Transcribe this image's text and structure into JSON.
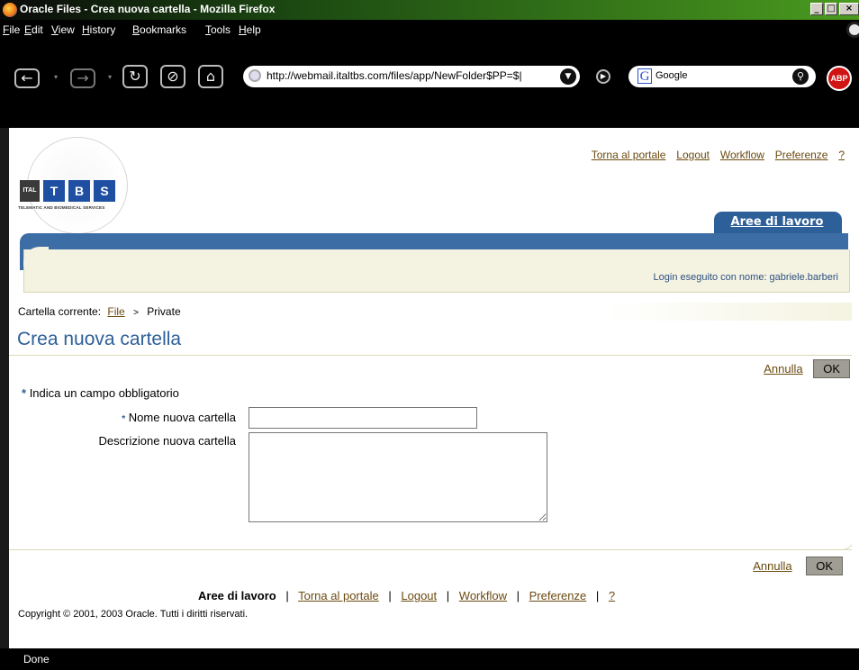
{
  "window": {
    "title": "Oracle Files - Crea nuova cartella - Mozilla Firefox",
    "buttons": [
      "_",
      "□",
      "×"
    ]
  },
  "menu": [
    "File",
    "Edit",
    "View",
    "History",
    "Bookmarks",
    "Tools",
    "Help"
  ],
  "toolbar": {
    "back_glyph": "←",
    "forward_glyph": "→",
    "reload_glyph": "↻",
    "stop_glyph": "⊘",
    "home_glyph": "⌂",
    "url": "http://webmail.italtbs.com/files/app/NewFolder$PP=$|",
    "search_engine": "Google",
    "search_engine_glyph": "G",
    "adblock_label": "ABP"
  },
  "logo": {
    "letters": [
      "ITAL",
      "T",
      "B",
      "S"
    ],
    "tagline": "TELEMATIC AND BIOMEDICAL SERVICES",
    "colors": {
      "box_blue": "#1f4fa3",
      "box_dark": "#3a3a3a"
    }
  },
  "global_links": [
    "Torna al portale",
    "Logout",
    "Workflow",
    "Preferenze",
    "?"
  ],
  "tab": {
    "label": "Aree di lavoro"
  },
  "login": {
    "text": "Login eseguito con nome: gabriele.barberi"
  },
  "breadcrumb": {
    "prefix": "Cartella corrente:",
    "link": "File",
    "separator": ">",
    "current": "Private"
  },
  "page": {
    "title": "Crea nuova cartella",
    "required_note": "Indica un campo obbligatorio",
    "required_star": "*"
  },
  "form": {
    "name_label": "Nome nuova cartella",
    "name_value": "",
    "desc_label": "Descrizione nuova cartella",
    "desc_value": ""
  },
  "actions": {
    "cancel": "Annulla",
    "ok": "OK"
  },
  "footer": {
    "current": "Aree di lavoro",
    "links": [
      "Torna al portale",
      "Logout",
      "Workflow",
      "Preferenze",
      "?"
    ],
    "separator": "|",
    "copyright": "Copyright © 2001, 2003 Oracle. Tutti i diritti riservati."
  },
  "status": {
    "text": "Done"
  },
  "colors": {
    "accent_blue": "#2d5f99",
    "link_brown": "#6b4a10",
    "panel_beige": "#f4f3e1"
  }
}
